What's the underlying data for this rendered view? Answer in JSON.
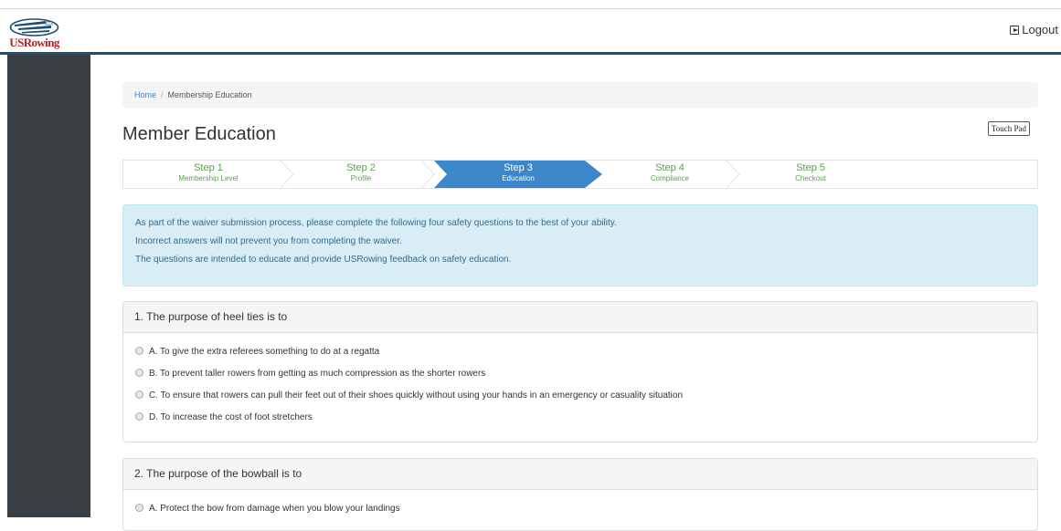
{
  "header": {
    "logo_text": "USRowing",
    "logout_label": "Logout"
  },
  "breadcrumb": {
    "home": "Home",
    "separator": "/",
    "current": "Membership Education"
  },
  "page_title": "Member Education",
  "steps": [
    {
      "title": "Step 1",
      "subtitle": "Membership Level",
      "state": "completed"
    },
    {
      "title": "Step 2",
      "subtitle": "Profile",
      "state": "completed"
    },
    {
      "title": "Step 3",
      "subtitle": "Education",
      "state": "active"
    },
    {
      "title": "Step 4",
      "subtitle": "Compliance",
      "state": "upcoming"
    },
    {
      "title": "Step 5",
      "subtitle": "Checkout",
      "state": "upcoming"
    }
  ],
  "info": {
    "lines": [
      "As part of the waiver submission process, please complete the following four safety questions to the best of your ability.",
      "Incorrect answers will not prevent you from completing the waiver.",
      "The questions are intended to educate and provide USRowing feedback on safety education."
    ]
  },
  "questions": [
    {
      "title": "1. The purpose of heel ties is to",
      "options": [
        "A. To give the extra referees something to do at a regatta",
        "B. To prevent taller rowers from getting as much compression as the shorter rowers",
        "C. To ensure that rowers can pull their feet out of their shoes quickly without using your hands in an emergency or casuality situation",
        "D. To increase the cost of foot stretchers"
      ]
    },
    {
      "title": "2. The purpose of the bowball is to",
      "options": [
        "A. Protect the bow from damage when you blow your landings"
      ]
    }
  ],
  "overlay": {
    "touch_pad_label": "Touch Pad"
  },
  "colors": {
    "header_border": "#1d4f72",
    "sidebar": "#3a3f44",
    "step_active": "#3b87c9",
    "step_done_text": "#5aa14d",
    "info_bg": "#d9edf7",
    "info_text": "#31708f",
    "link": "#3a7fc1",
    "logo_red": "#b22226",
    "logo_blue": "#1d4f72"
  },
  "icons": {
    "logout": "sign-out-icon",
    "radio": "radio-unchecked-icon"
  }
}
